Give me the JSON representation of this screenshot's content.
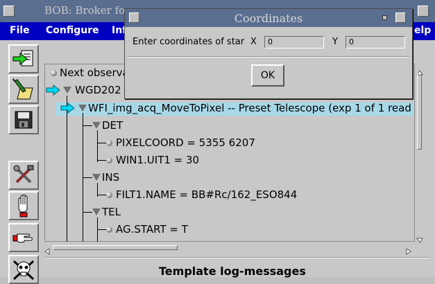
{
  "window": {
    "title": "BOB: Broker fo"
  },
  "menubar": {
    "file": "File",
    "configure": "Configure",
    "info": "Inf",
    "help": "elp"
  },
  "tree": {
    "rows": [
      {
        "label": "Next observa"
      },
      {
        "label": "WGD202"
      },
      {
        "label": "WFI_img_acq_MoveToPixel -- Preset Telescope (exp 1 of 1 read"
      },
      {
        "label": "DET"
      },
      {
        "label": "PIXELCOORD = 5355 6207"
      },
      {
        "label": "WIN1.UIT1 = 30"
      },
      {
        "label": "INS"
      },
      {
        "label": "FILT1.NAME = BB#Rc/162_ESO844"
      },
      {
        "label": "TEL"
      },
      {
        "label": "AG.START = T"
      }
    ]
  },
  "log": {
    "title": "Template log-messages"
  },
  "dialog": {
    "title": "Coordinates",
    "prompt": "Enter coordinates of star",
    "x_label": "X",
    "x_value": "0",
    "y_label": "Y",
    "y_value": "0",
    "ok_label": "OK"
  },
  "colors": {
    "titlebar": "#5a6e90",
    "menubar": "#0000c0",
    "selection": "#a8d8e8",
    "arrow": "#00d8f0"
  },
  "icons": {
    "toolbar": [
      "load-icon",
      "edit-icon",
      "save-icon",
      "tools-icon",
      "hand-stop-icon",
      "hand-pointing-icon",
      "skull-icon"
    ]
  }
}
